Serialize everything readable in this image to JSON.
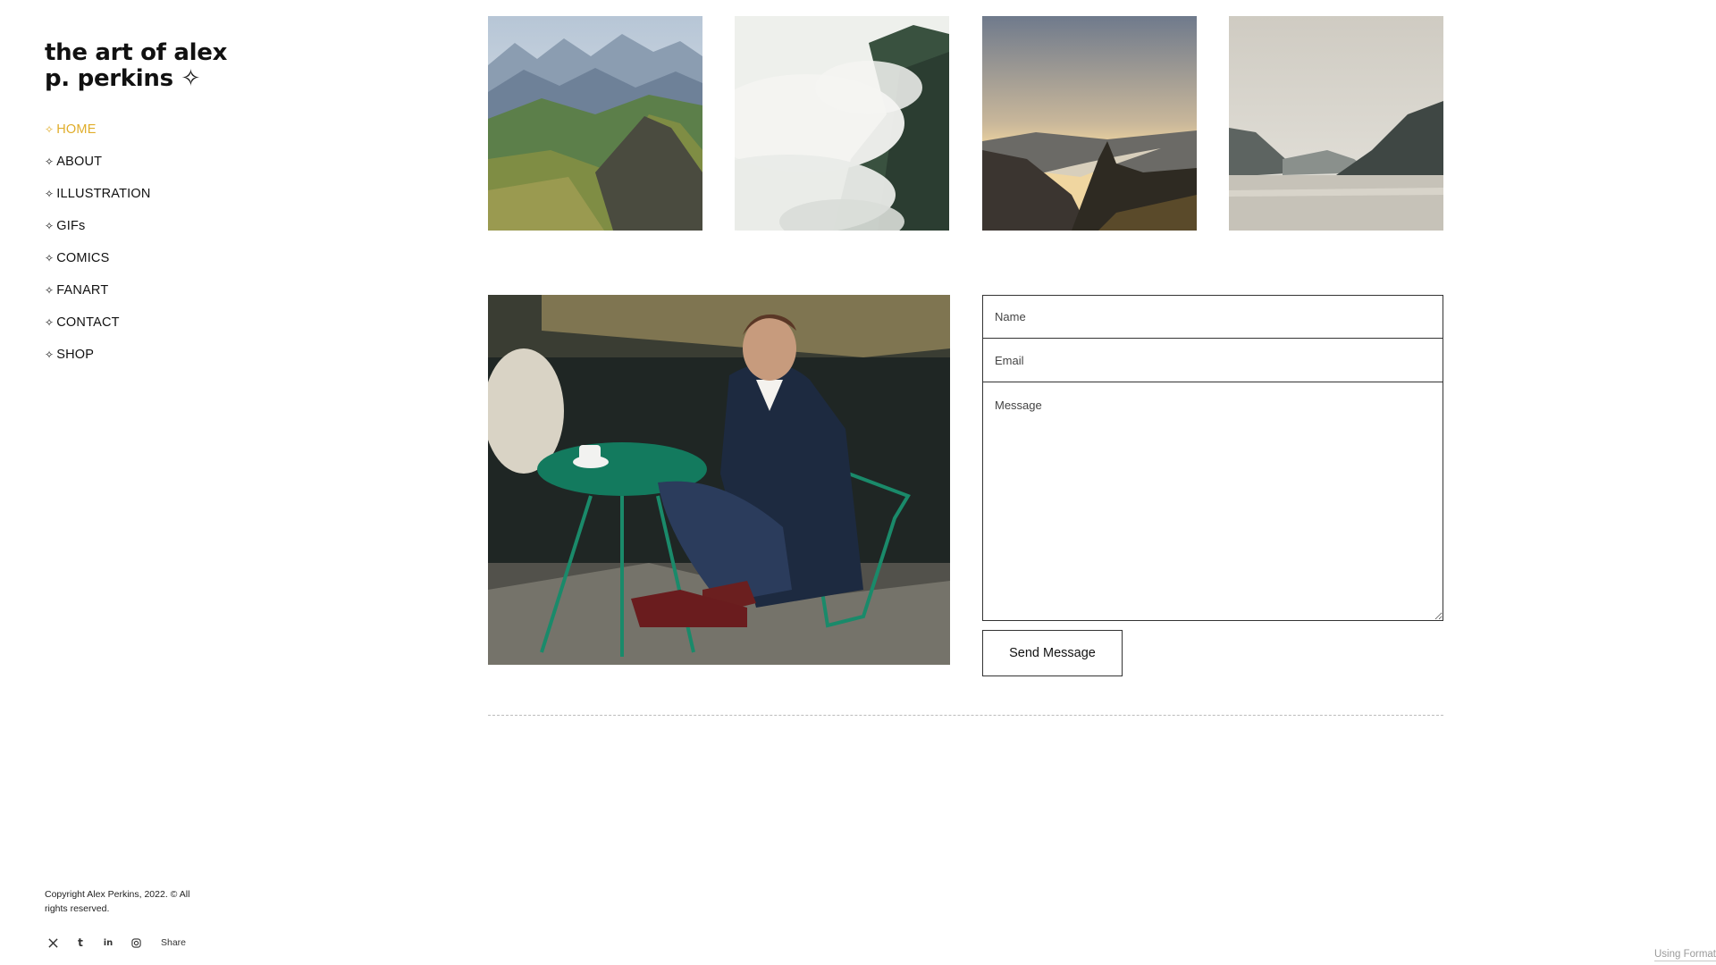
{
  "site": {
    "title": "the art of alex p. perkins ✧"
  },
  "nav": {
    "items": [
      {
        "label": "HOME",
        "active": true
      },
      {
        "label": "ABOUT"
      },
      {
        "label": "ILLUSTRATION"
      },
      {
        "label": "GIFs"
      },
      {
        "label": "COMICS"
      },
      {
        "label": "FANART"
      },
      {
        "label": "CONTACT"
      },
      {
        "label": "SHOP"
      }
    ],
    "bullet": "✧",
    "active_color": "#e0ad2a"
  },
  "gallery": {
    "images": [
      {
        "icon": "mountain-ridge-photo"
      },
      {
        "icon": "foggy-forest-photo"
      },
      {
        "icon": "sunset-valley-river-photo"
      },
      {
        "icon": "lake-mountains-photo"
      }
    ]
  },
  "contact": {
    "portrait": "man-at-cafe-table-photo",
    "name_placeholder": "Name",
    "email_placeholder": "Email",
    "message_placeholder": "Message",
    "send_label": "Send Message"
  },
  "footer": {
    "copyright": "Copyright Alex Perkins, 2022. © All rights reserved.",
    "social": [
      {
        "icon": "x-icon",
        "glyph": "𝕏"
      },
      {
        "icon": "tumblr-icon",
        "glyph": "t"
      },
      {
        "icon": "linkedin-icon",
        "glyph": "in"
      },
      {
        "icon": "instagram-icon",
        "glyph": ""
      }
    ],
    "share_label": "Share",
    "credit": "Using Format"
  }
}
